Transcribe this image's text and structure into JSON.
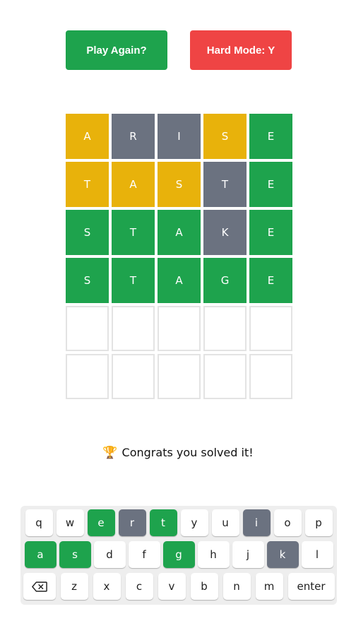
{
  "header": {
    "play_again_label": "Play Again?",
    "hard_mode_label": "Hard Mode: Y"
  },
  "board": {
    "rows": [
      [
        {
          "letter": "A",
          "state": "present"
        },
        {
          "letter": "R",
          "state": "absent"
        },
        {
          "letter": "I",
          "state": "absent"
        },
        {
          "letter": "S",
          "state": "present"
        },
        {
          "letter": "E",
          "state": "correct"
        }
      ],
      [
        {
          "letter": "T",
          "state": "present"
        },
        {
          "letter": "A",
          "state": "present"
        },
        {
          "letter": "S",
          "state": "present"
        },
        {
          "letter": "T",
          "state": "absent"
        },
        {
          "letter": "E",
          "state": "correct"
        }
      ],
      [
        {
          "letter": "S",
          "state": "correct"
        },
        {
          "letter": "T",
          "state": "correct"
        },
        {
          "letter": "A",
          "state": "correct"
        },
        {
          "letter": "K",
          "state": "absent"
        },
        {
          "letter": "E",
          "state": "correct"
        }
      ],
      [
        {
          "letter": "S",
          "state": "correct"
        },
        {
          "letter": "T",
          "state": "correct"
        },
        {
          "letter": "A",
          "state": "correct"
        },
        {
          "letter": "G",
          "state": "correct"
        },
        {
          "letter": "E",
          "state": "correct"
        }
      ],
      [
        {
          "letter": "",
          "state": "empty"
        },
        {
          "letter": "",
          "state": "empty"
        },
        {
          "letter": "",
          "state": "empty"
        },
        {
          "letter": "",
          "state": "empty"
        },
        {
          "letter": "",
          "state": "empty"
        }
      ],
      [
        {
          "letter": "",
          "state": "empty"
        },
        {
          "letter": "",
          "state": "empty"
        },
        {
          "letter": "",
          "state": "empty"
        },
        {
          "letter": "",
          "state": "empty"
        },
        {
          "letter": "",
          "state": "empty"
        }
      ]
    ]
  },
  "status": {
    "icon": "trophy-icon",
    "message": "Congrats you solved it!"
  },
  "keyboard": {
    "row1": [
      {
        "label": "q",
        "state": ""
      },
      {
        "label": "w",
        "state": ""
      },
      {
        "label": "e",
        "state": "correct"
      },
      {
        "label": "r",
        "state": "absent"
      },
      {
        "label": "t",
        "state": "correct"
      },
      {
        "label": "y",
        "state": ""
      },
      {
        "label": "u",
        "state": ""
      },
      {
        "label": "i",
        "state": "absent"
      },
      {
        "label": "o",
        "state": ""
      },
      {
        "label": "p",
        "state": ""
      }
    ],
    "row2": [
      {
        "label": "a",
        "state": "correct"
      },
      {
        "label": "s",
        "state": "correct"
      },
      {
        "label": "d",
        "state": ""
      },
      {
        "label": "f",
        "state": ""
      },
      {
        "label": "g",
        "state": "correct"
      },
      {
        "label": "h",
        "state": ""
      },
      {
        "label": "j",
        "state": ""
      },
      {
        "label": "k",
        "state": "absent"
      },
      {
        "label": "l",
        "state": ""
      }
    ],
    "row3": [
      {
        "label": "",
        "state": "",
        "icon": "backspace-icon"
      },
      {
        "label": "z",
        "state": ""
      },
      {
        "label": "x",
        "state": ""
      },
      {
        "label": "c",
        "state": ""
      },
      {
        "label": "v",
        "state": ""
      },
      {
        "label": "b",
        "state": ""
      },
      {
        "label": "n",
        "state": ""
      },
      {
        "label": "m",
        "state": ""
      },
      {
        "label": "enter",
        "state": ""
      }
    ]
  },
  "colors": {
    "correct": "#1ea34d",
    "present": "#e8b20b",
    "absent": "#6b7280",
    "hard_mode": "#ef4444"
  }
}
